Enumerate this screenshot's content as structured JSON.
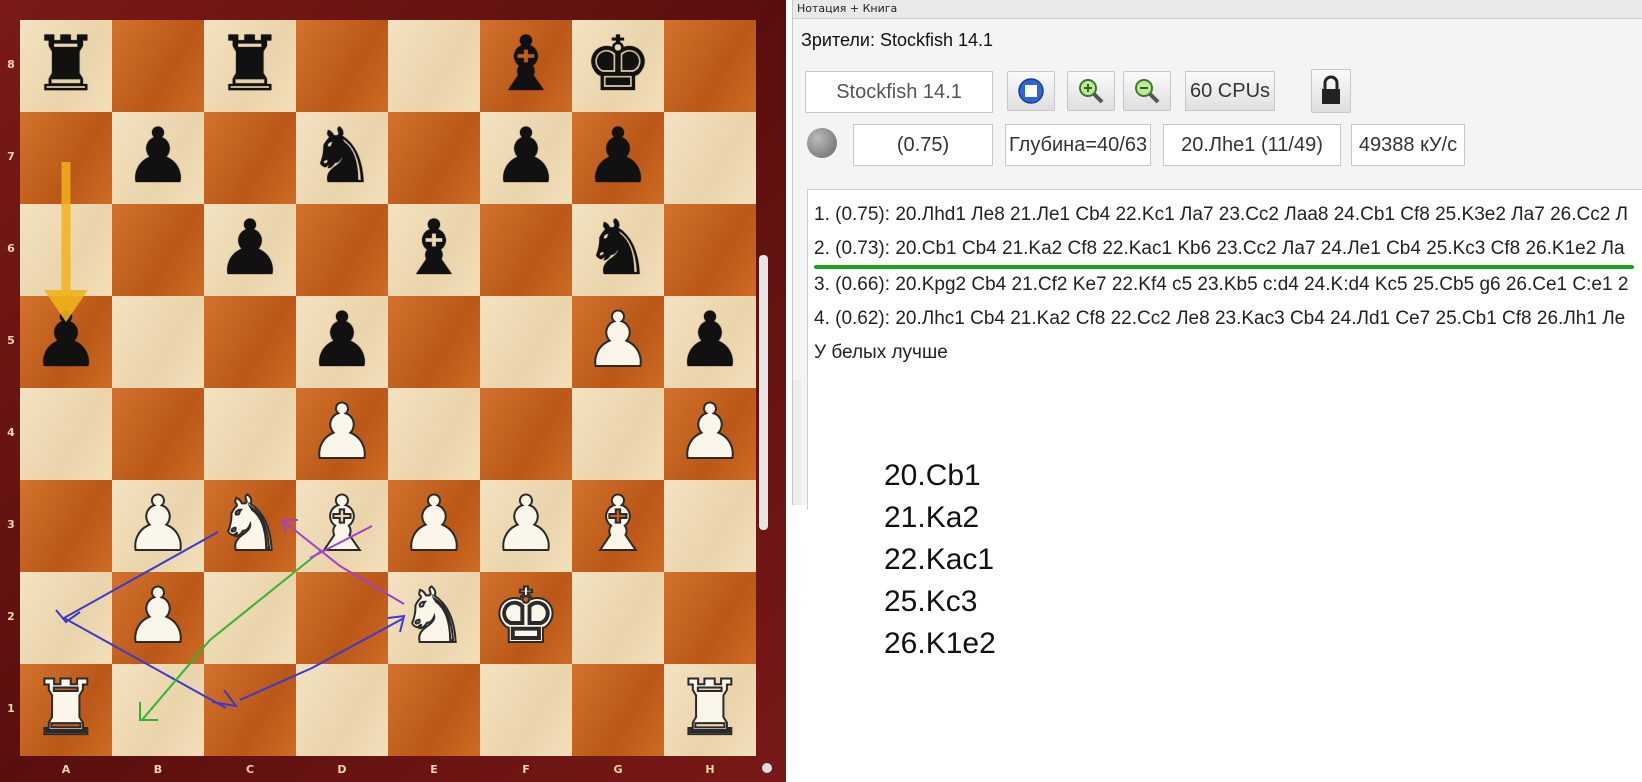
{
  "board": {
    "files": [
      "A",
      "B",
      "C",
      "D",
      "E",
      "F",
      "G",
      "H"
    ],
    "ranks": [
      "8",
      "7",
      "6",
      "5",
      "4",
      "3",
      "2",
      "1"
    ],
    "pieces": [
      {
        "sq": "a8",
        "p": "♜",
        "c": "black"
      },
      {
        "sq": "c8",
        "p": "♜",
        "c": "black"
      },
      {
        "sq": "f8",
        "p": "♝",
        "c": "black"
      },
      {
        "sq": "g8",
        "p": "♚",
        "c": "black"
      },
      {
        "sq": "b7",
        "p": "♟",
        "c": "black"
      },
      {
        "sq": "d7",
        "p": "♞",
        "c": "black"
      },
      {
        "sq": "f7",
        "p": "♟",
        "c": "black"
      },
      {
        "sq": "g7",
        "p": "♟",
        "c": "black"
      },
      {
        "sq": "c6",
        "p": "♟",
        "c": "black"
      },
      {
        "sq": "e6",
        "p": "♝",
        "c": "black"
      },
      {
        "sq": "g6",
        "p": "♞",
        "c": "black"
      },
      {
        "sq": "a5",
        "p": "♟",
        "c": "black"
      },
      {
        "sq": "d5",
        "p": "♟",
        "c": "black"
      },
      {
        "sq": "g5",
        "p": "♟",
        "c": "white"
      },
      {
        "sq": "h5",
        "p": "♟",
        "c": "black"
      },
      {
        "sq": "d4",
        "p": "♟",
        "c": "white"
      },
      {
        "sq": "h4",
        "p": "♟",
        "c": "white"
      },
      {
        "sq": "b3",
        "p": "♟",
        "c": "white"
      },
      {
        "sq": "c3",
        "p": "♞",
        "c": "white"
      },
      {
        "sq": "d3",
        "p": "♝",
        "c": "white"
      },
      {
        "sq": "e3",
        "p": "♟",
        "c": "white"
      },
      {
        "sq": "f3",
        "p": "♟",
        "c": "white"
      },
      {
        "sq": "g3",
        "p": "♝",
        "c": "white"
      },
      {
        "sq": "b2",
        "p": "♟",
        "c": "white"
      },
      {
        "sq": "e2",
        "p": "♞",
        "c": "white"
      },
      {
        "sq": "f2",
        "p": "♚",
        "c": "white"
      },
      {
        "sq": "a1",
        "p": "♜",
        "c": "white"
      },
      {
        "sq": "h1",
        "p": "♜",
        "c": "white"
      }
    ],
    "colors": {
      "light": "#f0dcb4",
      "dark": "#c9621d",
      "frame": "#6b1413"
    }
  },
  "panel": {
    "title": "Нотация + Книга",
    "spectators": "Зрители: Stockfish 14.1",
    "engine_name": "Stockfish 14.1",
    "cpus": "60 CPUs",
    "eval": "(0.75)",
    "depth": "Глубина=40/63",
    "current_move": "20.Лhe1 (11/49)",
    "speed": "49388 кУ/с",
    "lines": [
      "1. (0.75): 20.Лhd1 Ле8 21.Ле1 Cb4 22.Kc1 Ла7 23.Cc2 Лаа8 24.Cb1 Cf8 25.K3e2 Ла7 26.Cc2 Л",
      "2. (0.73): 20.Cb1 Cb4 21.Ka2 Cf8 22.Kac1 Kb6 23.Cc2 Ла7 24.Ле1 Cb4 25.Kc3 Cf8 26.K1e2 Ла",
      "3. (0.66): 20.Kpg2 Cb4 21.Cf2 Ke7 22.Kf4 c5 23.Kb5 c:d4 24.K:d4 Kc5 25.Cb5 g6 26.Ce1 C:e1 2",
      "4. (0.62): 20.Лhc1 Cb4 21.Ka2 Cf8 22.Cc2 Ле8 23.Kac3 Cb4 24.Лd1 Ce7 25.Cb1 Cf8 26.Лh1 Ле"
    ],
    "assessment": "У белых лучше"
  },
  "moves": [
    "20.Cb1",
    "21.Ka2",
    "22.Kac1",
    "25.Kc3",
    "26.K1e2"
  ]
}
